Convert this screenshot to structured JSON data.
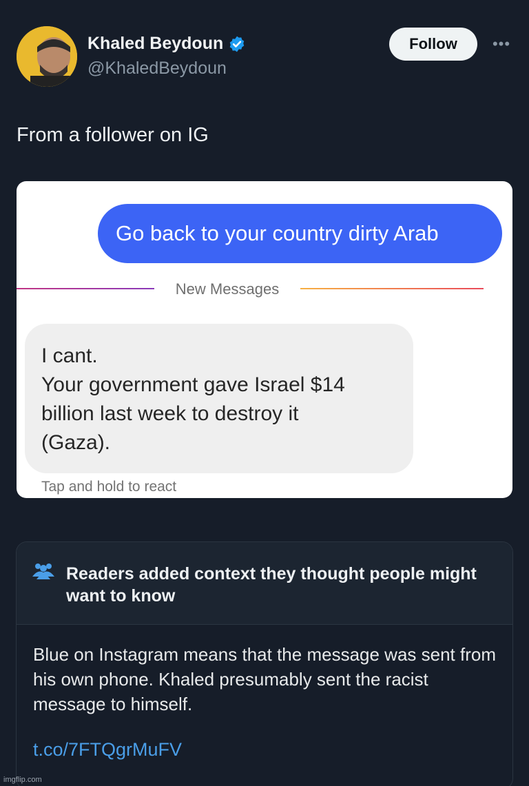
{
  "tweet": {
    "author_name": "Khaled Beydoun",
    "author_handle": "@KhaledBeydoun",
    "follow_label": "Follow",
    "more_label": "•••",
    "text": "From a follower on IG"
  },
  "instagram_screenshot": {
    "outgoing_message": "Go back to your country dirty Arab",
    "divider_label": "New Messages",
    "incoming_message_lines": [
      "I cant.",
      "Your government gave Israel $14",
      "billion last week to destroy it",
      "(Gaza)."
    ],
    "react_hint": "Tap and hold to react"
  },
  "community_note": {
    "title": "Readers added context they thought people might want to know",
    "body": "Blue on Instagram means that the message was sent from his own phone. Khaled presumably sent the racist message to himself.",
    "link": "t.co/7FTQgrMuFV"
  },
  "watermark": "imgflip.com",
  "colors": {
    "background": "#161d29",
    "verified_badge": "#1d9bf0",
    "outgoing_bubble": "#3c64f5",
    "link": "#4a9ee8"
  },
  "icons": [
    "avatar",
    "verified-badge-icon",
    "more-icon",
    "people-icon"
  ]
}
